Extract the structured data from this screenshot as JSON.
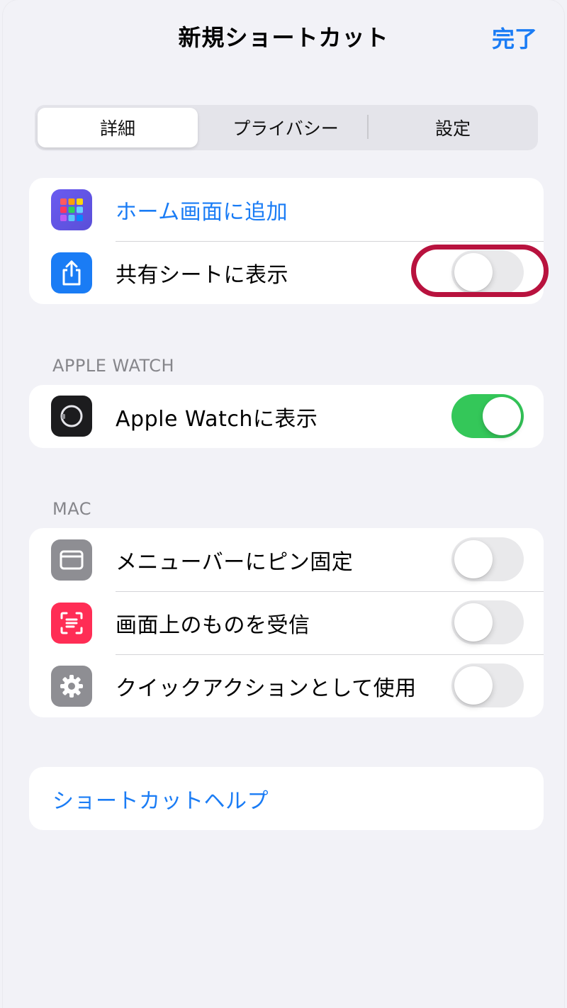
{
  "nav": {
    "title": "新規ショートカット",
    "done_label": "完了"
  },
  "segments": [
    {
      "label": "詳細",
      "selected": true
    },
    {
      "label": "プライバシー",
      "selected": false
    },
    {
      "label": "設定",
      "selected": false
    }
  ],
  "general_group": {
    "items": [
      {
        "label": "ホーム画面に追加",
        "icon": "app-grid-icon"
      },
      {
        "label": "共有シートに表示",
        "icon": "share-icon",
        "toggle_on": false,
        "highlighted": true
      }
    ]
  },
  "watch_section": {
    "header": "APPLE WATCH",
    "items": [
      {
        "label": "Apple Watchに表示",
        "icon": "apple-watch-icon",
        "toggle_on": true
      }
    ]
  },
  "mac_section": {
    "header": "MAC",
    "items": [
      {
        "label": "メニューバーにピン固定",
        "icon": "menubar-window-icon",
        "toggle_on": false
      },
      {
        "label": "画面上のものを受信",
        "icon": "text-scan-icon",
        "toggle_on": false
      },
      {
        "label": "クイックアクションとして使用",
        "icon": "gear-icon",
        "toggle_on": false
      }
    ]
  },
  "help": {
    "label": "ショートカットヘルプ"
  },
  "colors": {
    "accent": "#1a7cf5",
    "toggle_on": "#34c759",
    "highlight": "#b8123e",
    "background": "#f2f2f7"
  }
}
